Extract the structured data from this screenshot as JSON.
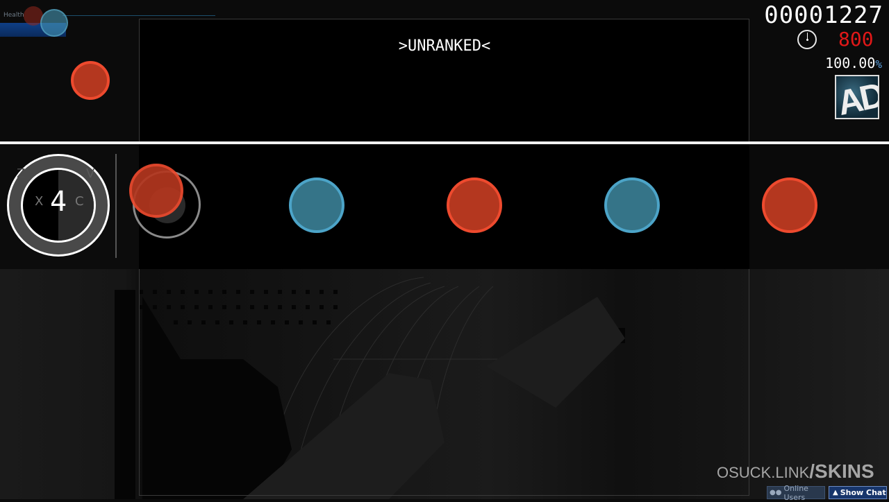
{
  "hud": {
    "health_label": "Health",
    "score": "00001227",
    "combo_counter": "800",
    "accuracy_value": "100.00",
    "accuracy_symbol": "%",
    "mod_badge": "AD",
    "status_banner": ">UNRANKED<"
  },
  "drum": {
    "combo": "4",
    "keys": {
      "outer_left": "Z",
      "inner_left": "X",
      "inner_right": "C",
      "outer_right": "V"
    }
  },
  "notes": [
    {
      "type": "don",
      "color": "red"
    },
    {
      "type": "kat",
      "color": "blue"
    },
    {
      "type": "don",
      "color": "red"
    },
    {
      "type": "kat",
      "color": "blue"
    },
    {
      "type": "don",
      "color": "red"
    }
  ],
  "watermark": {
    "domain": "OSUCK.LINK",
    "slash": "/",
    "path": "SKINS"
  },
  "buttons": {
    "online_users": "Online Users",
    "show_chat": "Show Chat"
  },
  "icons": {
    "online_users": "users-icon",
    "show_chat": "chevron-up-icon",
    "timer": "clock-icon"
  },
  "colors": {
    "don": "#ee4a2e",
    "kat": "#4ca4c8",
    "combo_counter": "#e01818",
    "accuracy_symbol": "#5aa0e0",
    "chat_button": "#17356b"
  }
}
